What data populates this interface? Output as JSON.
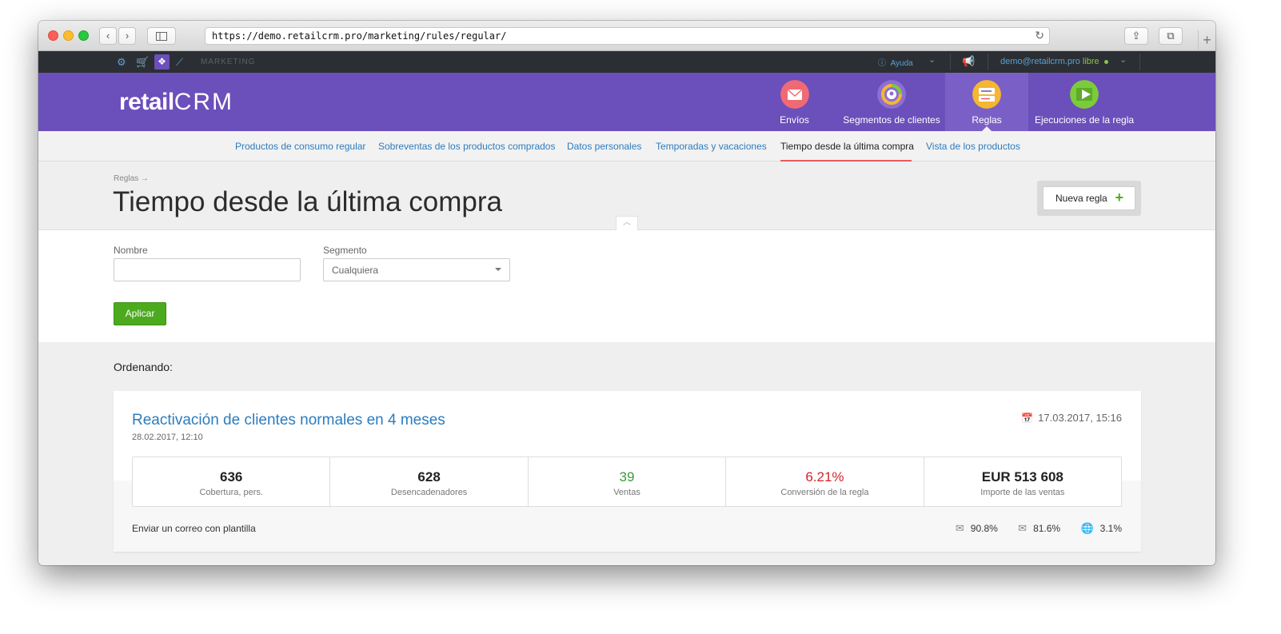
{
  "browser": {
    "url": "https://demo.retailcrm.pro/marketing/rules/regular/"
  },
  "topbar": {
    "section": "MARKETING",
    "help": "Ayuda",
    "user_email": "demo@retailcrm.pro",
    "plan": "libre"
  },
  "header": {
    "logo_left": "retail",
    "logo_right": "CRM",
    "nav": [
      {
        "label": "Envíos",
        "icon": "envelope-circle-icon",
        "color": "#f06a74"
      },
      {
        "label": "Segmentos de clientes",
        "icon": "segments-circle-icon",
        "color": "#8d6fd1"
      },
      {
        "label": "Reglas",
        "icon": "rules-circle-icon",
        "color": "#f5b731"
      },
      {
        "label": "Ejecuciones de la regla",
        "icon": "play-circle-icon",
        "color": "#7ccb3b"
      }
    ]
  },
  "subnav": [
    "Productos de consumo regular",
    "Sobreventas de los productos comprados",
    "Datos personales",
    "Temporadas y vacaciones",
    "Tiempo desde la última compra",
    "Vista de los productos"
  ],
  "page": {
    "breadcrumb": "Reglas →",
    "title": "Tiempo desde la última compra",
    "new_rule_label": "Nueva regla"
  },
  "filters": {
    "name_label": "Nombre",
    "name_value": "",
    "segment_label": "Segmento",
    "segment_value": "Cualquiera",
    "apply_label": "Aplicar"
  },
  "listing": {
    "sorting_label": "Ordenando:",
    "rules": [
      {
        "title": "Reactivación de clientes normales en 4 meses",
        "created": "28.02.2017, 12:10",
        "date": "17.03.2017, 15:16",
        "stats": [
          {
            "value": "636",
            "label": "Cobertura, pers.",
            "color": "#222222"
          },
          {
            "value": "628",
            "label": "Desencadenadores",
            "color": "#222222"
          },
          {
            "value": "39",
            "label": "Ventas",
            "color": "#3d9a3d"
          },
          {
            "value": "6.21%",
            "label": "Conversión de la regla",
            "color": "#d0242a"
          },
          {
            "value": "EUR 513 608",
            "label": "Importe de las ventas",
            "color": "#222222"
          }
        ],
        "action": "Enviar un correo con plantilla",
        "metrics": [
          {
            "icon": "mail-sent-icon",
            "value": "90.8%"
          },
          {
            "icon": "mail-open-icon",
            "value": "81.6%"
          },
          {
            "icon": "globe-click-icon",
            "value": "3.1%"
          }
        ]
      }
    ]
  }
}
